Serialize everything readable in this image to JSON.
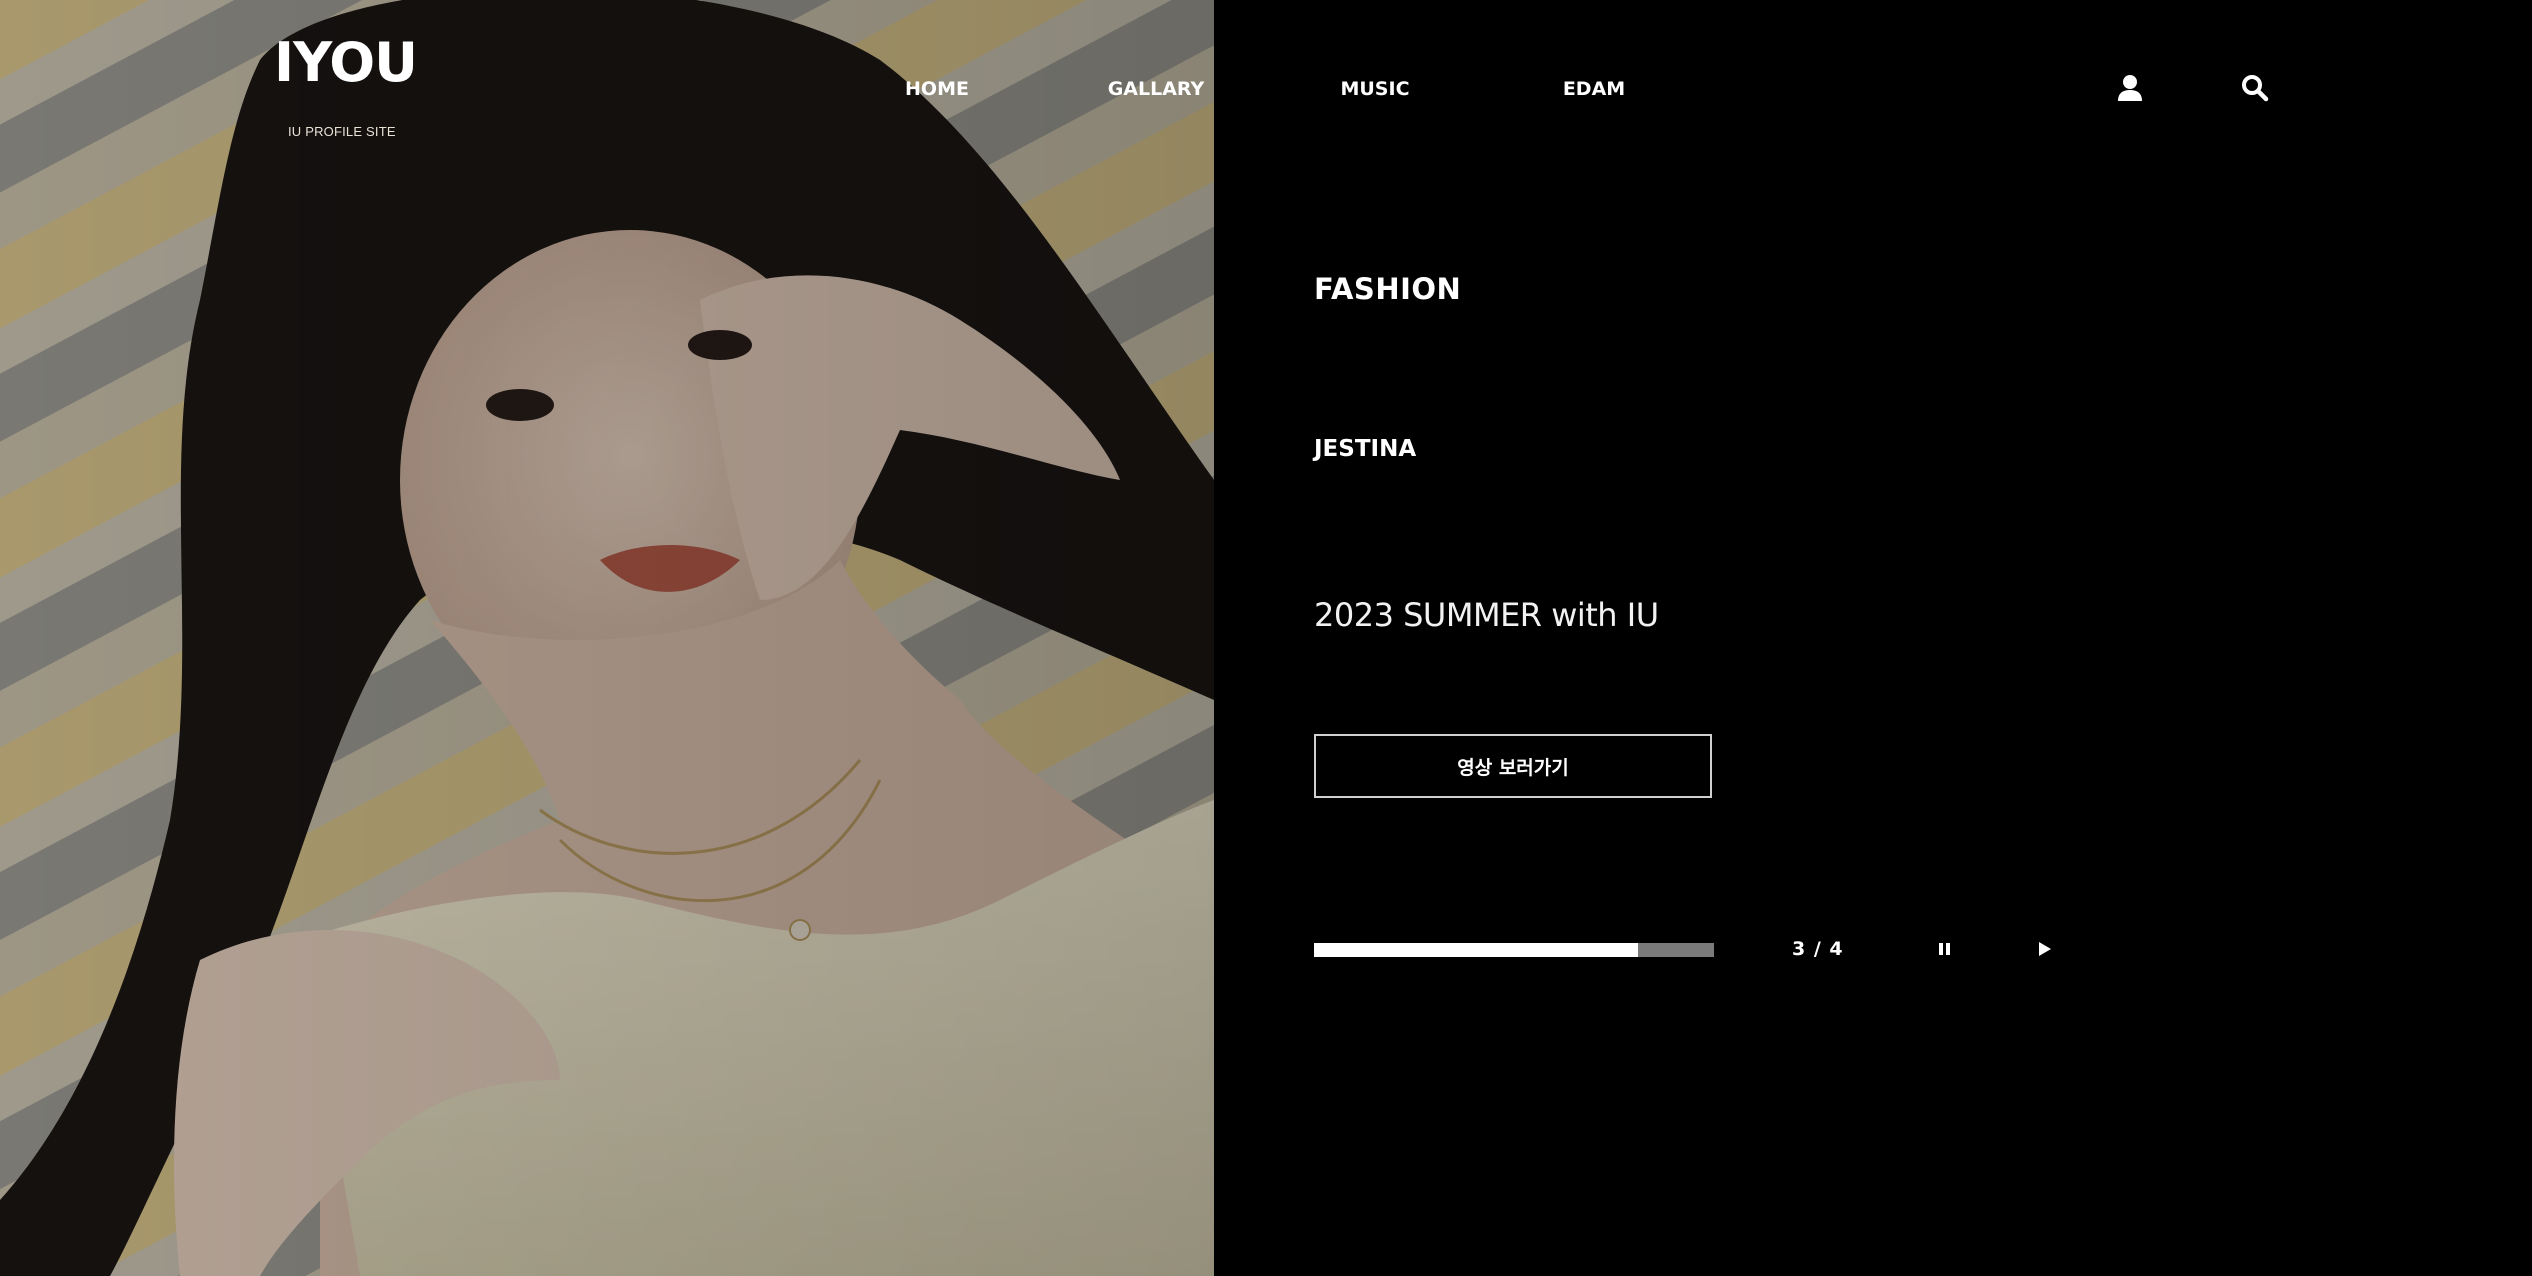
{
  "header": {
    "logo": "IYOU",
    "logo_sub": "IU PROFILE SITE",
    "nav": [
      "HOME",
      "GALLARY",
      "MUSIC",
      "EDAM"
    ],
    "icons": [
      "user-icon",
      "search-icon"
    ]
  },
  "hero": {
    "image_icon": "portrait-photo",
    "category": "FASHION",
    "brand": "JESTINA",
    "headline": "2023 SUMMER with IU",
    "video_button": "영상 보러가기"
  },
  "slider": {
    "progress": 0.81,
    "counter": "3 / 4",
    "current": 3,
    "total": 4,
    "controls": [
      "pause-icon",
      "play-icon"
    ]
  },
  "colors": {
    "background": "#000000",
    "text": "#ffffff",
    "progress_track": "#7a7a7a",
    "progress_fill": "#ffffff",
    "button_border": "#cfcfcf"
  }
}
